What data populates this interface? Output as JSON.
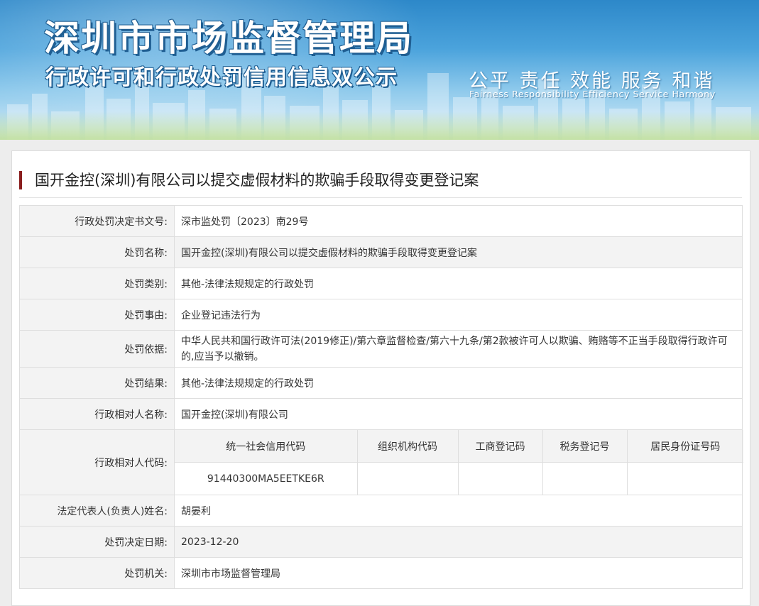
{
  "banner": {
    "title": "深圳市市场监督管理局",
    "subtitle": "行政许可和行政处罚信用信息双公示",
    "slogan_cn": "公平 责任 效能 服务 和谐",
    "slogan_en": "Fairness Responsibility Efficiency Service Harmony"
  },
  "page": {
    "heading": "国开金控(深圳)有限公司以提交虚假材料的欺骗手段取得变更登记案"
  },
  "table": {
    "rows": [
      {
        "label": "行政处罚决定书文号:",
        "value": "深市监处罚〔2023〕南29号"
      },
      {
        "label": "处罚名称:",
        "value": "国开金控(深圳)有限公司以提交虚假材料的欺骗手段取得变更登记案"
      },
      {
        "label": "处罚类别:",
        "value": "其他-法律法规规定的行政处罚"
      },
      {
        "label": "处罚事由:",
        "value": "企业登记违法行为"
      },
      {
        "label": "处罚依据:",
        "value": "中华人民共和国行政许可法(2019修正)/第六章监督检查/第六十九条/第2款被许可人以欺骗、贿赂等不正当手段取得行政许可的,应当予以撤销。"
      },
      {
        "label": "处罚结果:",
        "value": "其他-法律法规规定的行政处罚"
      },
      {
        "label": "行政相对人名称:",
        "value": "国开金控(深圳)有限公司"
      }
    ],
    "codes": {
      "label": "行政相对人代码:",
      "headers": [
        "统一社会信用代码",
        "组织机构代码",
        "工商登记码",
        "税务登记号",
        "居民身份证号码"
      ],
      "values": [
        "91440300MA5EETKE6R",
        "",
        "",
        "",
        ""
      ]
    },
    "rows_after": [
      {
        "label": "法定代表人(负责人)姓名:",
        "value": "胡晏利"
      },
      {
        "label": "处罚决定日期:",
        "value": "2023-12-20"
      },
      {
        "label": "处罚机关:",
        "value": "深圳市市场监督管理局"
      }
    ]
  },
  "colors": {
    "heading_bar": "#8a1e1e",
    "banner_sky": "#4ba3dc"
  }
}
